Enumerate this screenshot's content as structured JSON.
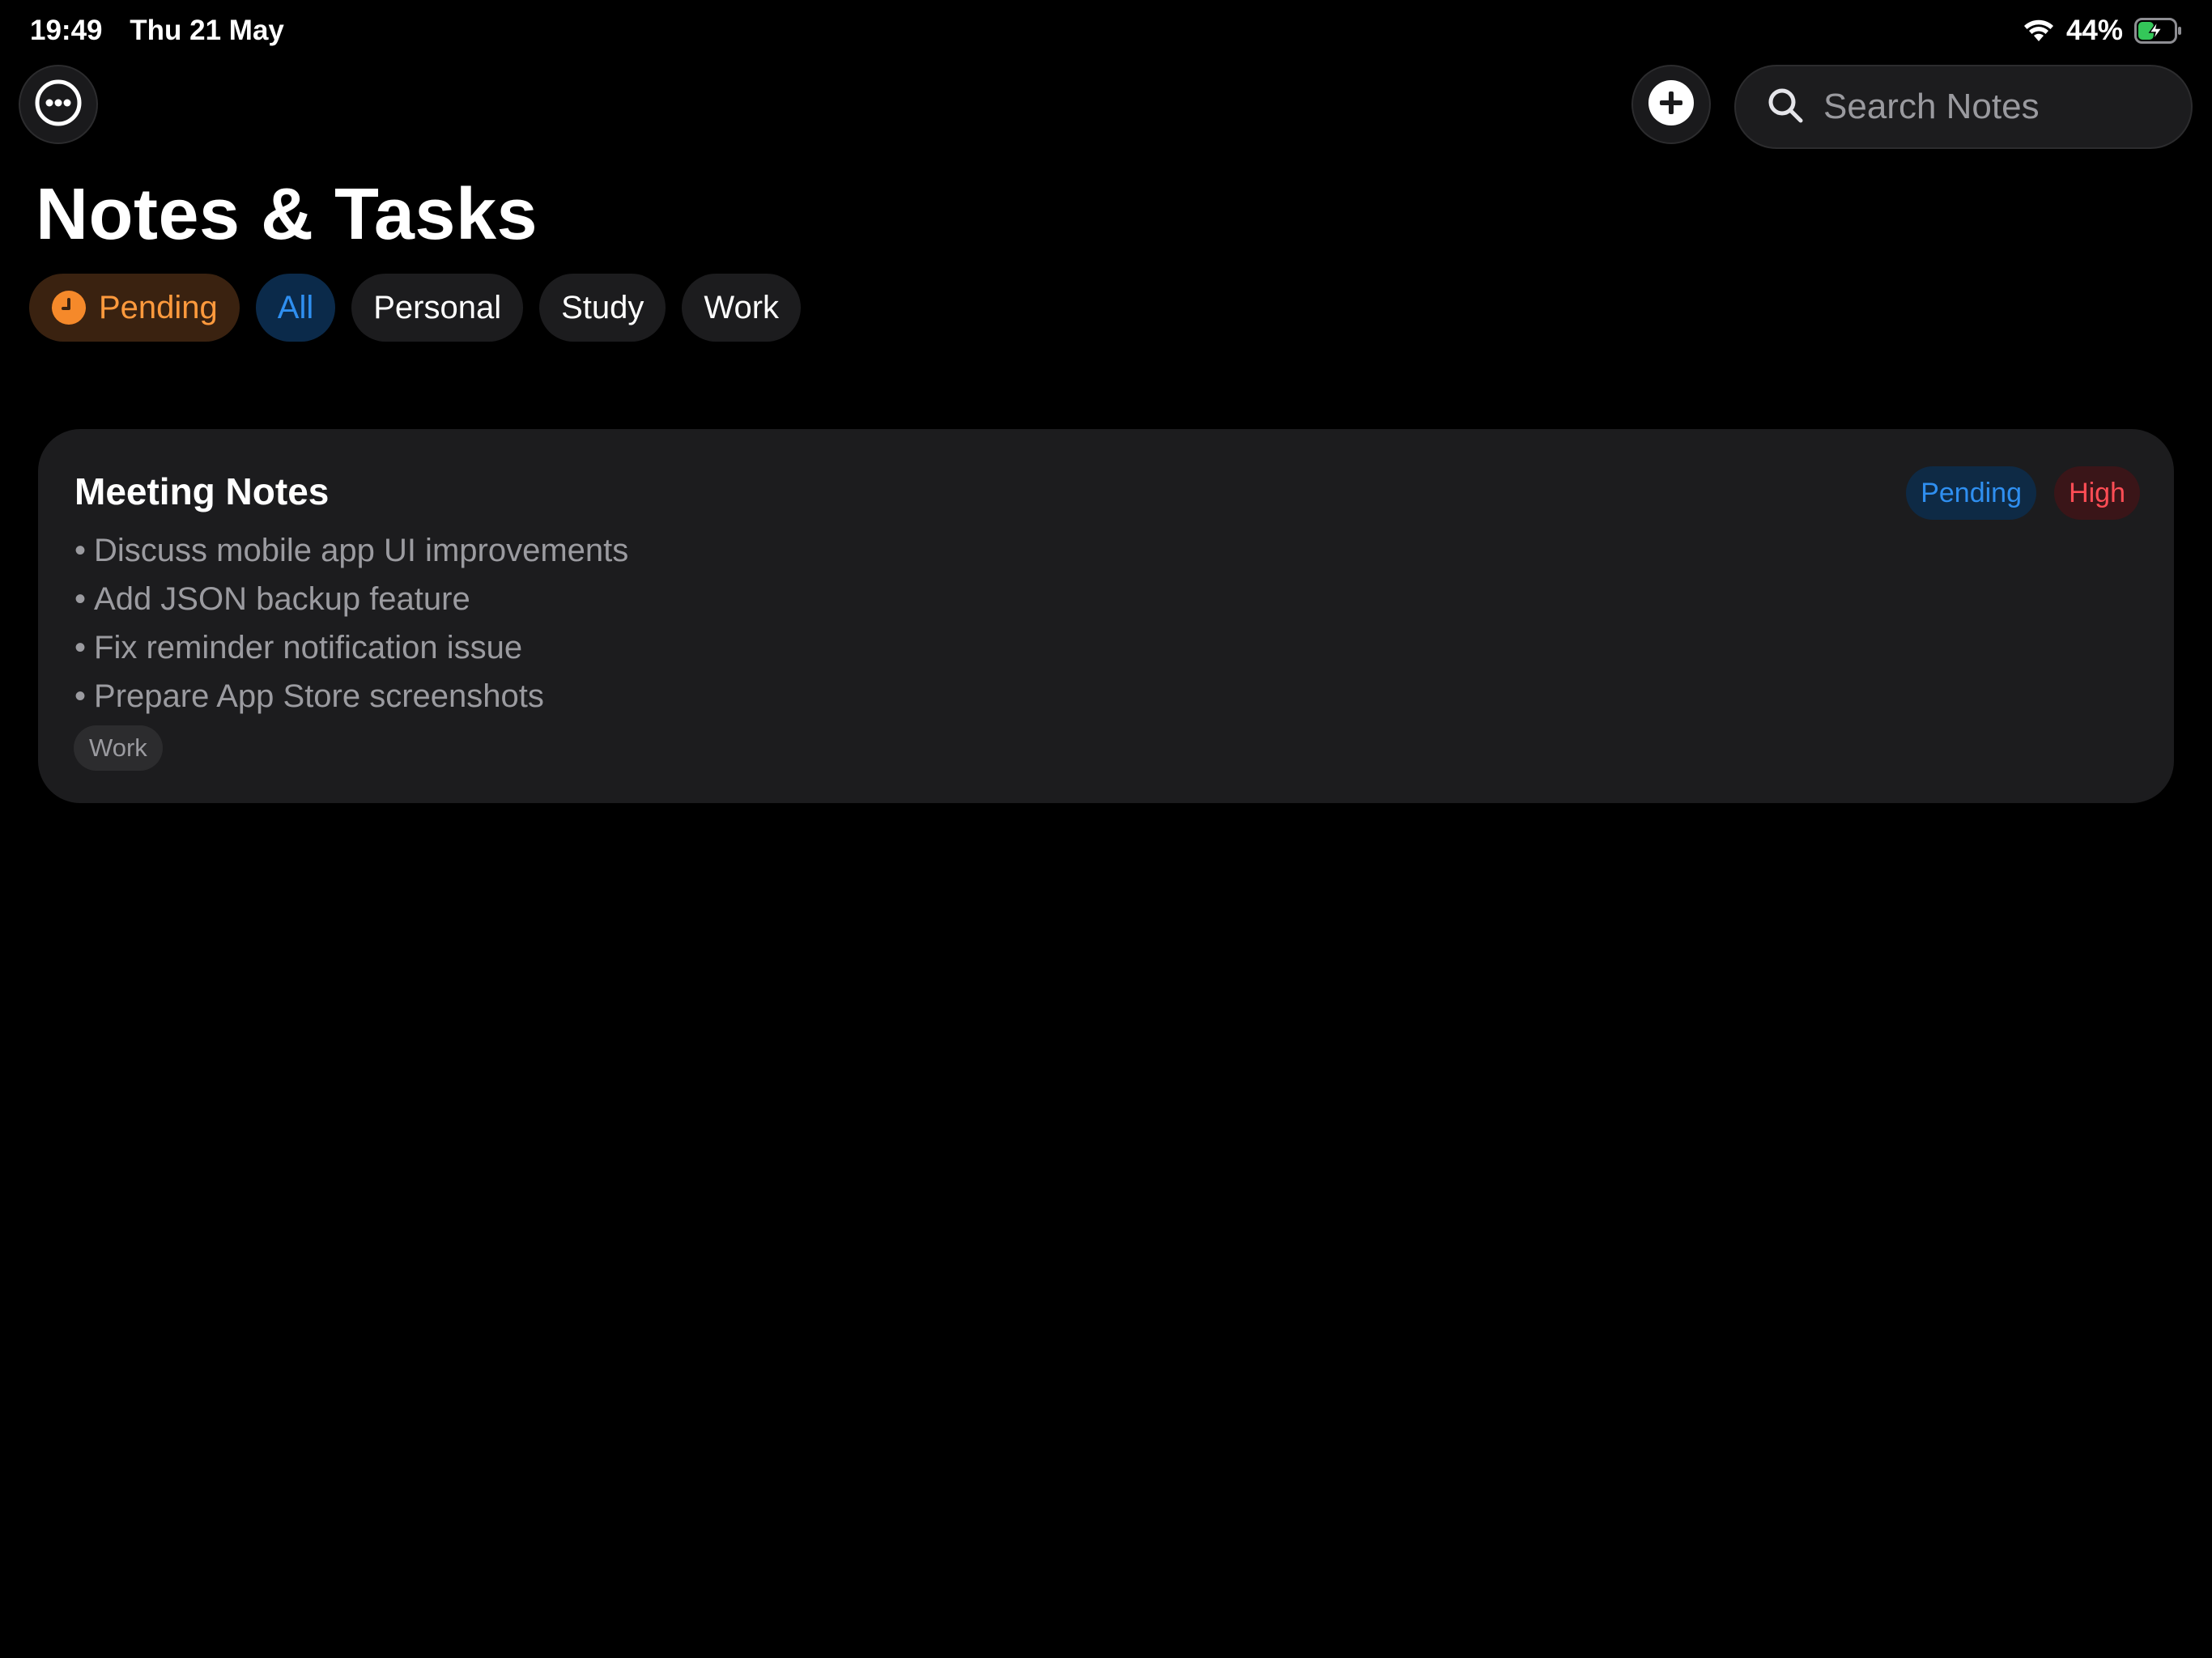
{
  "status_bar": {
    "time": "19:49",
    "date": "Thu 21 May",
    "battery_percent": "44%",
    "battery_level": 0.44,
    "charging": true
  },
  "toolbar": {
    "more_icon": "ellipsis-circle-icon",
    "add_icon": "plus-circle-icon",
    "search": {
      "placeholder": "Search Notes",
      "value": "",
      "icon": "magnifying-glass-icon"
    }
  },
  "header": {
    "title": "Notes & Tasks"
  },
  "filters": {
    "pending_label": "Pending",
    "all_label": "All",
    "personal_label": "Personal",
    "study_label": "Study",
    "work_label": "Work",
    "selected": "All"
  },
  "notes": [
    {
      "title": "Meeting Notes",
      "status": "Pending",
      "priority": "High",
      "lines": [
        "Discuss mobile app UI improvements",
        "Add JSON backup feature",
        "Fix reminder notification issue",
        "Prepare App Store screenshots"
      ],
      "tag": "Work"
    }
  ],
  "colors": {
    "background": "#000000",
    "card": "#1c1c1e",
    "accent_blue": "#2f8ff0",
    "pending_orange": "#ff9a3d",
    "priority_red": "#ff4d55",
    "secondary_text": "#9b9ba0",
    "battery_green": "#34c759"
  }
}
